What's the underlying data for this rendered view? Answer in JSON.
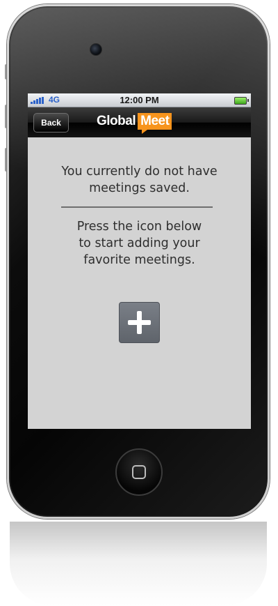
{
  "status_bar": {
    "network": "4G",
    "time": "12:00 PM"
  },
  "nav": {
    "back_label": "Back",
    "logo_part1": "Global",
    "logo_part2": "Meet"
  },
  "content": {
    "empty_line1": "You currently do not have",
    "empty_line2": "meetings saved.",
    "hint_line1": "Press the icon below",
    "hint_line2": "to start adding your",
    "hint_line3": "favorite meetings."
  },
  "icons": {
    "add": "plus-icon",
    "signal": "signal-strength-icon",
    "battery": "battery-icon"
  },
  "colors": {
    "brand_orange": "#f7941d",
    "content_bg": "#d3d3d3",
    "add_button": "#6b7078",
    "network_blue": "#2c62c9"
  }
}
